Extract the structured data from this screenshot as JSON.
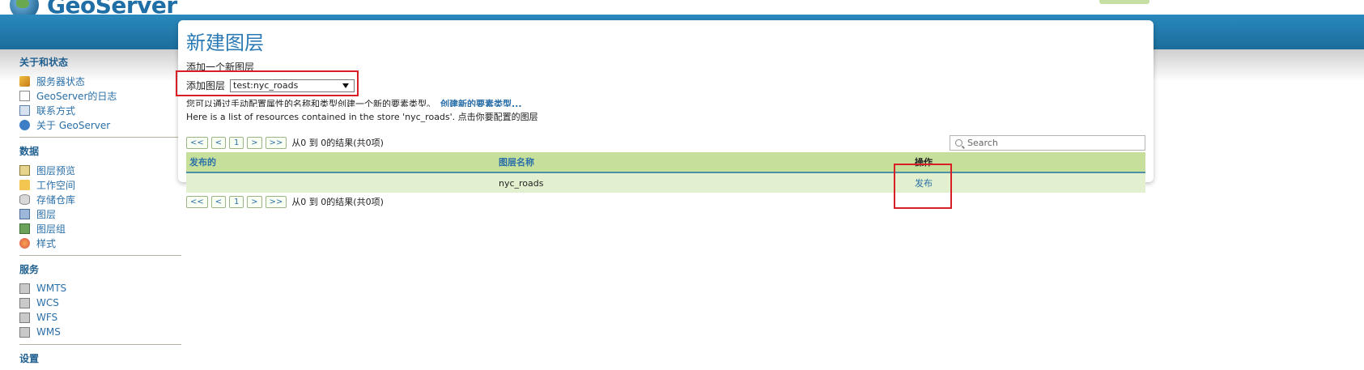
{
  "header": {
    "logo_text": "GeoServer"
  },
  "sidebar": {
    "sections": [
      {
        "title": "关于和状态",
        "items": [
          "服务器状态",
          "GeoServer的日志",
          "联系方式",
          "关于 GeoServer"
        ]
      },
      {
        "title": "数据",
        "items": [
          "图层预览",
          "工作空间",
          "存储仓库",
          "图层",
          "图层组",
          "样式"
        ]
      },
      {
        "title": "服务",
        "items": [
          "WMTS",
          "WCS",
          "WFS",
          "WMS"
        ]
      },
      {
        "title": "设置",
        "items": []
      }
    ]
  },
  "main": {
    "title": "新建图层",
    "subtitle": "添加一个新图层",
    "add_layer_label": "添加图层",
    "selected_store": "test:nyc_roads",
    "hint_text": "您可以通过手动配置属性的名称和类型创建一个新的要素类型。",
    "hint_link": "创建新的要素类型...",
    "store_line": "Here is a list of resources contained in the store 'nyc_roads'. 点击你要配置的图层",
    "pager": {
      "first": "<<",
      "prev": "<",
      "page": "1",
      "next": ">",
      "last": ">>",
      "info": "从0 到 0的结果(共0项)"
    },
    "search_placeholder": "Search",
    "table": {
      "headers": [
        "发布的",
        "图层名称",
        "操作"
      ],
      "rows": [
        {
          "published": "",
          "name": "nyc_roads",
          "action": "发布"
        }
      ]
    }
  },
  "colors": {
    "accent_blue": "#2b7ab5",
    "table_header": "#c6df9b",
    "table_row": "#e2f0cf",
    "highlight_red": "#d91f26"
  }
}
